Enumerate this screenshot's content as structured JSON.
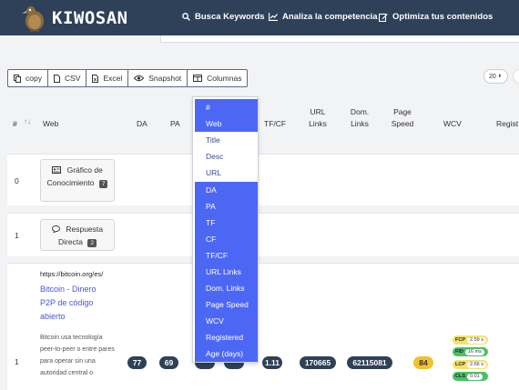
{
  "brand": {
    "name": "KIWOSAN"
  },
  "nav": [
    {
      "label": "Busca Keywords",
      "icon": "search-icon"
    },
    {
      "label": "Analiza la competencia",
      "icon": "chart-icon"
    },
    {
      "label": "Optimiza tus contenidos",
      "icon": "edit-icon"
    }
  ],
  "toolbar": {
    "copy": "copy",
    "csv": "CSV",
    "excel": "Excel",
    "snapshot": "Snapshot",
    "columnas": "Columnas"
  },
  "page_size": {
    "value": "20"
  },
  "table": {
    "headers": {
      "num": "#",
      "web": "Web",
      "da": "DA",
      "pa": "PA",
      "tfcf": "TF/CF",
      "url_links": "URL Links",
      "dom_links": "Dom. Links",
      "page_speed": "Page Speed",
      "wcv": "WCV",
      "registered": "Regist"
    },
    "rows": [
      {
        "num": "0",
        "card_label": "Gráfico de Conocimiento",
        "card_count": "7"
      },
      {
        "num": "1",
        "card_label": "Respuesta Directa",
        "card_count": "2"
      },
      {
        "num": "1",
        "url": "https://bitcoin.org/es/",
        "title": "Bitcoin - Dinero P2P de código abierto",
        "desc": "Bitcoin usa tecnología peer-to-peer o entre pares para operar sin una autoridad central o",
        "da": "77",
        "pa": "69",
        "tf": "1.11",
        "url_links": "170665",
        "dom_links": "62115081",
        "page_speed": "84",
        "cwv": [
          {
            "key": "FCP",
            "value": "2.59 s",
            "color": "#f2e46a"
          },
          {
            "key": "FID",
            "value": "16 ms",
            "color": "#4bbf6b"
          },
          {
            "key": "LCP",
            "value": "2.66 s",
            "color": "#f2e46a"
          },
          {
            "key": "CLS",
            "value": "0.01",
            "color": "#4bbf6b"
          }
        ]
      }
    ]
  },
  "column_menu": {
    "items": [
      {
        "label": "#",
        "active": true
      },
      {
        "label": "Web",
        "active": true
      },
      {
        "label": "Title",
        "active": false
      },
      {
        "label": "Desc",
        "active": false
      },
      {
        "label": "URL",
        "active": false
      },
      {
        "label": "DA",
        "active": true
      },
      {
        "label": "PA",
        "active": true
      },
      {
        "label": "TF",
        "active": true
      },
      {
        "label": "CF",
        "active": true
      },
      {
        "label": "TF/CF",
        "active": true
      },
      {
        "label": "URL Links",
        "active": true
      },
      {
        "label": "Dom. Links",
        "active": true
      },
      {
        "label": "Page Speed",
        "active": true
      },
      {
        "label": "WCV",
        "active": true
      },
      {
        "label": "Registered",
        "active": true
      },
      {
        "label": "Age (days)",
        "active": true
      }
    ]
  },
  "colors": {
    "nav_bg": "#2e4158",
    "menu_active": "#4d67f5",
    "link": "#4a55d6",
    "pill_dark": "#2f4157",
    "pill_yellow": "#f2c12e"
  }
}
